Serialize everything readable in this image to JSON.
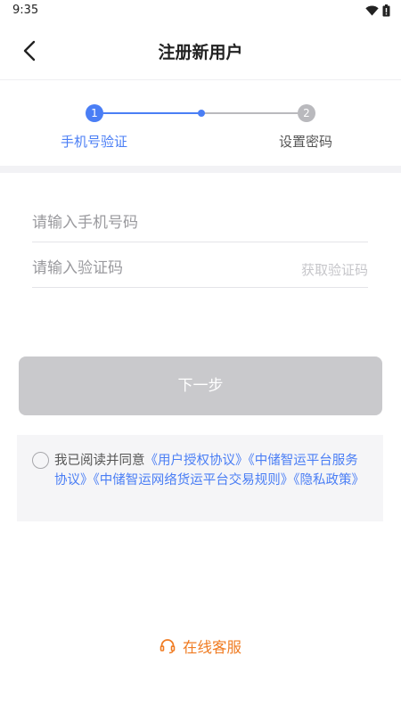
{
  "status_bar": {
    "time": "9:35"
  },
  "header": {
    "title": "注册新用户"
  },
  "steps": [
    {
      "number": "1",
      "label": "手机号验证",
      "active": true
    },
    {
      "number": "2",
      "label": "设置密码",
      "active": false
    }
  ],
  "form": {
    "phone_placeholder": "请输入手机号码",
    "phone_value": "",
    "code_placeholder": "请输入验证码",
    "code_value": "",
    "get_code_label": "获取验证码"
  },
  "next_button": {
    "label": "下一步",
    "enabled": false
  },
  "agreement": {
    "prefix": "我已阅读并同意",
    "links": [
      "《用户授权协议》",
      "《中储智运平台服务协议》",
      "《中储智运网络货运平台交易规则》",
      "《隐私政策》"
    ]
  },
  "service": {
    "label": "在线客服",
    "icon": "headset-icon"
  },
  "colors": {
    "accent": "#4a7ef5",
    "inactive": "#b9b9bd",
    "button_disabled": "#c9c9cc",
    "service": "#f07c23"
  }
}
